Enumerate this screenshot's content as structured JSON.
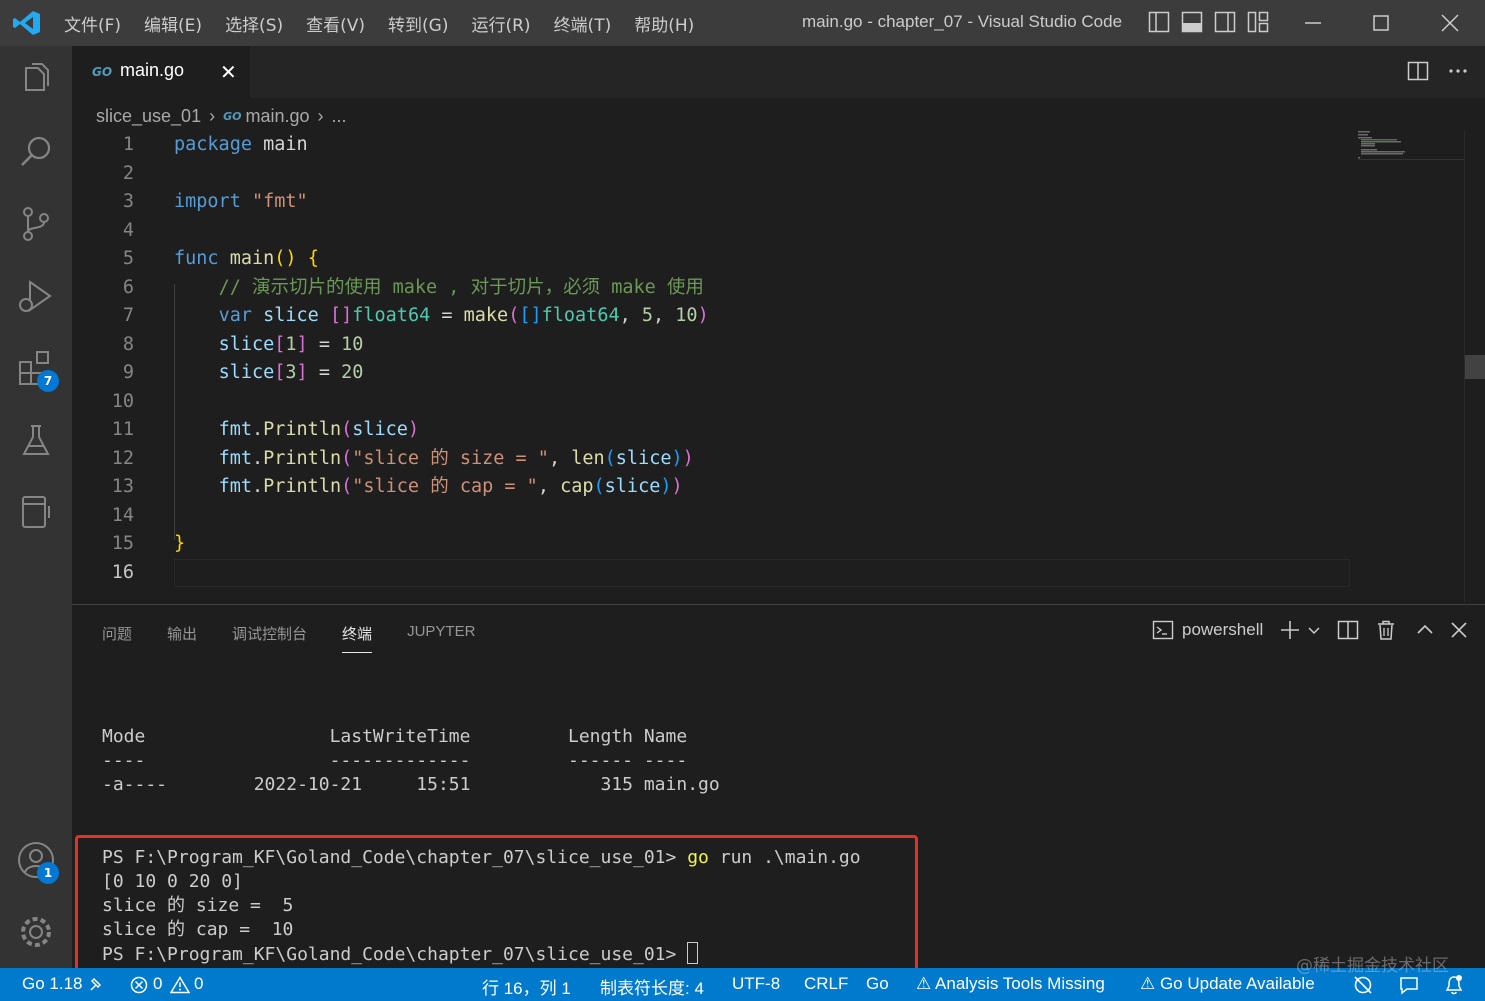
{
  "menu": [
    "文件(F)",
    "编辑(E)",
    "选择(S)",
    "查看(V)",
    "转到(G)",
    "运行(R)",
    "终端(T)",
    "帮助(H)"
  ],
  "window_title": "main.go - chapter_07 - Visual Studio Code",
  "activity_badges": {
    "extensions": "7",
    "accounts": "1"
  },
  "tab": {
    "go_icon_text": "GO",
    "name": "main.go",
    "close": "✕"
  },
  "breadcrumb": {
    "folder": "slice_use_01",
    "file": "main.go",
    "more": "..."
  },
  "code": {
    "line_numbers": [
      "1",
      "2",
      "3",
      "4",
      "5",
      "6",
      "7",
      "8",
      "9",
      "10",
      "11",
      "12",
      "13",
      "14",
      "15",
      "16"
    ],
    "comment": "// 演示切片的使用 make , 对于切片，必须 make 使用",
    "str_fmt": "\"fmt\"",
    "str_size": "\"slice 的 size = \"",
    "str_cap": "\"slice 的 cap = \""
  },
  "panel": {
    "tabs": [
      "问题",
      "输出",
      "调试控制台",
      "终端",
      "JUPYTER"
    ],
    "active_tab": "终端",
    "shell": "powershell"
  },
  "terminal": {
    "header": "Mode                 LastWriteTime         Length Name",
    "dashes": "----                 -------------         ------ ----",
    "file_row": "-a----        2022-10-21     15:51            315 main.go",
    "prompt": "PS F:\\Program_KF\\Goland_Code\\chapter_07\\slice_use_01>",
    "cmd_go": "go",
    "cmd_rest": " run .\\main.go",
    "out1": "[0 10 0 20 0]",
    "out2": "slice 的 size =  5",
    "out3": "slice 的 cap =  10"
  },
  "status": {
    "go_version": "Go 1.18",
    "errors": "0",
    "warnings": "0",
    "position": "行 16，列 1",
    "tab_size": "制表符长度: 4",
    "encoding": "UTF-8",
    "eol": "CRLF",
    "language": "Go",
    "analysis": "⚠ Analysis Tools Missing",
    "go_update": "⚠ Go Update Available"
  },
  "watermark": "@稀土掘金技术社区",
  "colors": {
    "accent": "#007acc",
    "titlebar": "#3c3c3c",
    "activitybar": "#333333",
    "editor": "#1e1e1e",
    "highlight_box": "#e3322a"
  }
}
